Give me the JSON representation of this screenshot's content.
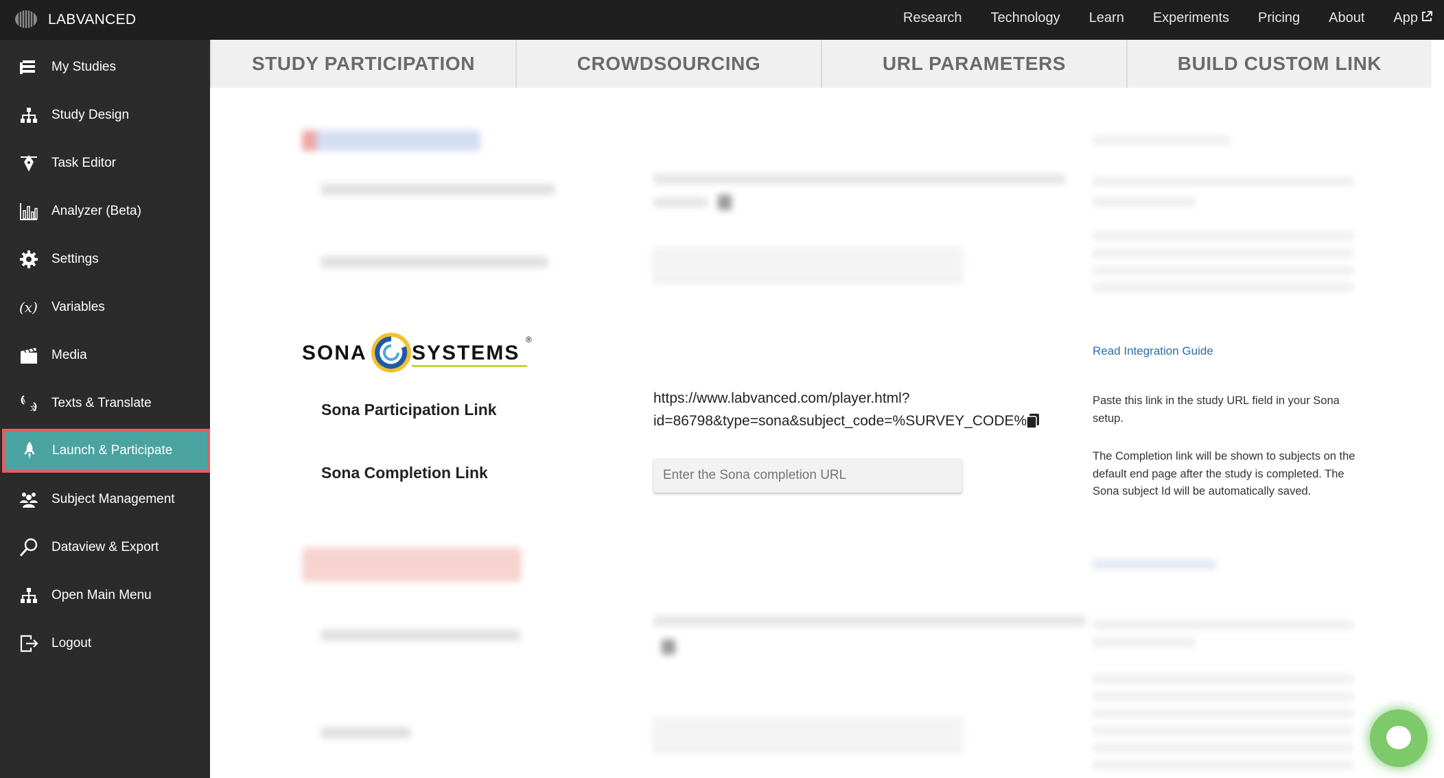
{
  "brand": {
    "name": "LABVANCED"
  },
  "topnav": [
    "Research",
    "Technology",
    "Learn",
    "Experiments",
    "Pricing",
    "About",
    "App"
  ],
  "sidebar": {
    "items": [
      {
        "label": "My Studies",
        "icon": "list-icon"
      },
      {
        "label": "Study Design",
        "icon": "hierarchy-icon"
      },
      {
        "label": "Task Editor",
        "icon": "pen-icon"
      },
      {
        "label": "Analyzer (Beta)",
        "icon": "chart-icon"
      },
      {
        "label": "Settings",
        "icon": "gear-icon"
      },
      {
        "label": "Variables",
        "icon": "variable-icon"
      },
      {
        "label": "Media",
        "icon": "media-icon"
      },
      {
        "label": "Texts & Translate",
        "icon": "translate-icon"
      },
      {
        "label": "Launch & Participate",
        "icon": "rocket-icon"
      },
      {
        "label": "Subject Management",
        "icon": "users-icon"
      },
      {
        "label": "Dataview & Export",
        "icon": "search-icon"
      },
      {
        "label": "Open Main Menu",
        "icon": "hierarchy-icon"
      },
      {
        "label": "Logout",
        "icon": "logout-icon"
      }
    ],
    "active_index": 8,
    "accent": "#4aa3a1",
    "highlight": "#e35e5e"
  },
  "tabs": [
    "STUDY PARTICIPATION",
    "CROWDSOURCING",
    "URL PARAMETERS",
    "BUILD CUSTOM LINK"
  ],
  "sona": {
    "logo_text_left": "SONA",
    "logo_text_right": "SYSTEMS",
    "logo_mark": "®",
    "guide_link": "Read Integration Guide",
    "participation_label": "Sona Participation Link",
    "participation_url_line1": "https://www.labvanced.com/player.html?",
    "participation_url_line2": "id=86798&type=sona&subject_code=%SURVEY_CODE%",
    "participation_hint": "Paste this link in the study URL field in your Sona setup.",
    "completion_label": "Sona Completion Link",
    "completion_placeholder": "Enter the Sona completion URL",
    "completion_hint": "The Completion link will be shown to subjects on the default end page after the study is completed. The Sona subject Id will be automatically saved."
  }
}
